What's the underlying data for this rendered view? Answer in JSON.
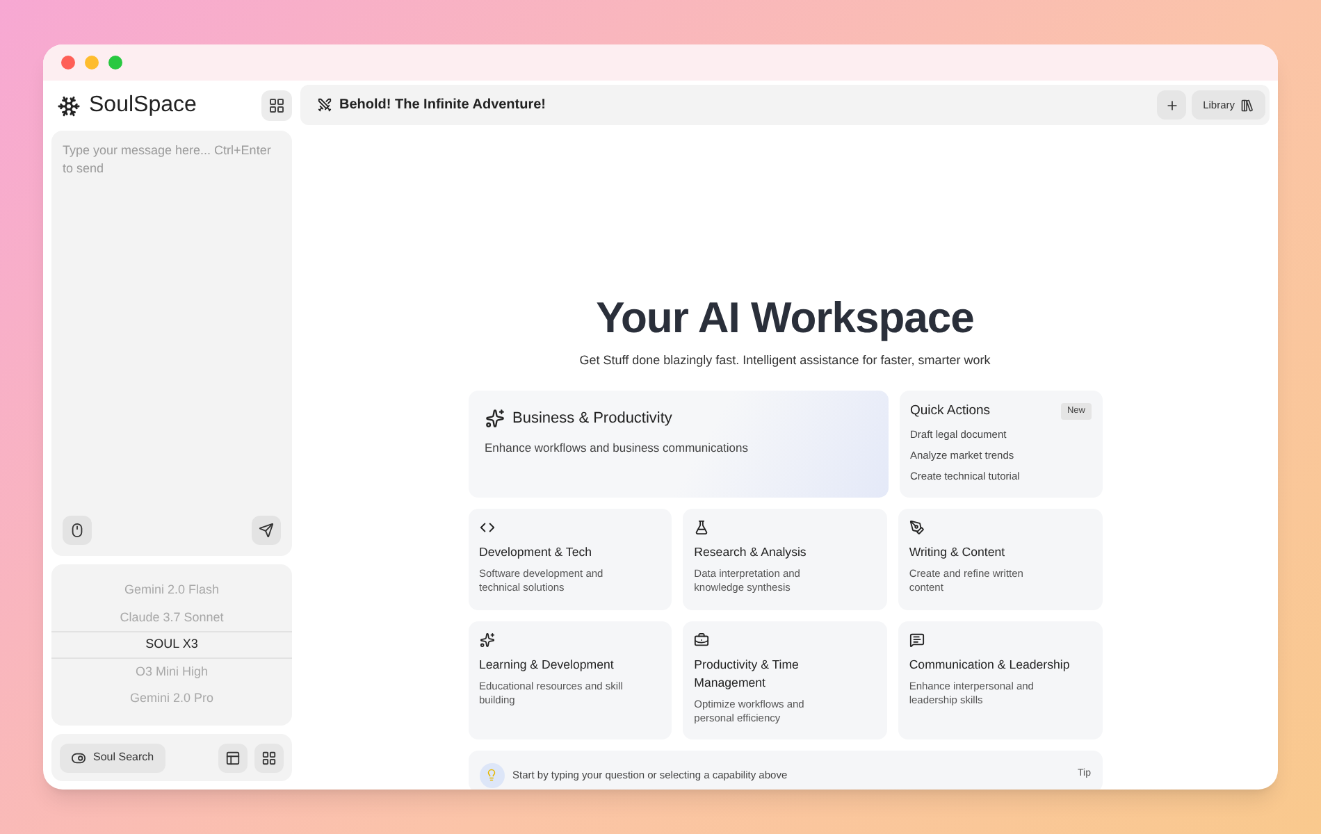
{
  "sidebar": {
    "brand": "SoulSpace",
    "composer": {
      "placeholder": "Type your message here... Ctrl+Enter to send"
    },
    "models": [
      {
        "label": "Gemini 2.0 Flash",
        "selected": false
      },
      {
        "label": "Claude 3.7 Sonnet",
        "selected": false
      },
      {
        "label": "SOUL X3",
        "selected": true
      },
      {
        "label": "O3 Mini High",
        "selected": false
      },
      {
        "label": "Gemini 2.0 Pro",
        "selected": false
      }
    ],
    "search_button": "Soul Search"
  },
  "header": {
    "title": "Behold! The Infinite Adventure!",
    "library_button": "Library"
  },
  "hero": {
    "title": "Your AI Workspace",
    "subtitle": "Get Stuff done blazingly fast. Intelligent assistance for faster, smarter work"
  },
  "featured": {
    "title": "Business & Productivity",
    "description": "Enhance workflows and business communications"
  },
  "quick_actions": {
    "title": "Quick Actions",
    "badge": "New",
    "items": [
      "Draft legal document",
      "Analyze market trends",
      "Create technical tutorial"
    ]
  },
  "capabilities": [
    {
      "title": "Development & Tech",
      "description": "Software development and technical solutions"
    },
    {
      "title": "Research & Analysis",
      "description": "Data interpretation and knowledge synthesis"
    },
    {
      "title": "Writing & Content",
      "description": "Create and refine written content"
    },
    {
      "title": "Learning & Development",
      "description": "Educational resources and skill building"
    },
    {
      "title": "Productivity & Time Management",
      "description": "Optimize workflows and personal efficiency"
    },
    {
      "title": "Communication & Leadership",
      "description": "Enhance interpersonal and leadership skills"
    }
  ],
  "tip": {
    "text": "Start by typing your question or selecting a capability above",
    "label": "Tip"
  }
}
